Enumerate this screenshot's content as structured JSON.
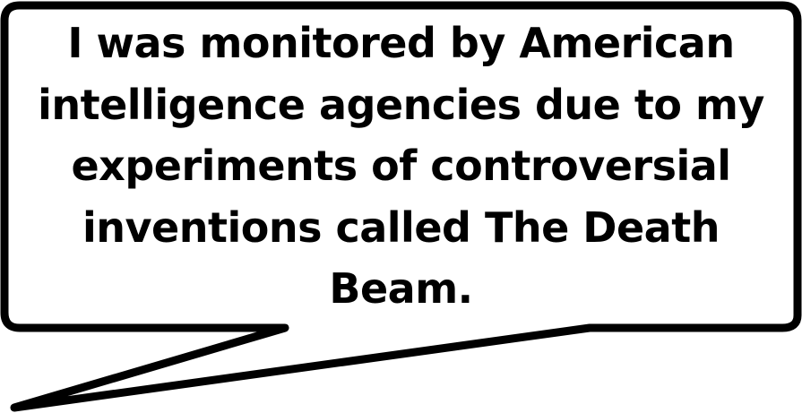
{
  "speech_bubble": {
    "lines": [
      "I was monitored by American",
      "intelligence agencies due to my",
      "experiments of controversial",
      "inventions called The Death",
      "Beam."
    ],
    "fill_color": "#ffffff",
    "stroke_color": "#000000"
  }
}
